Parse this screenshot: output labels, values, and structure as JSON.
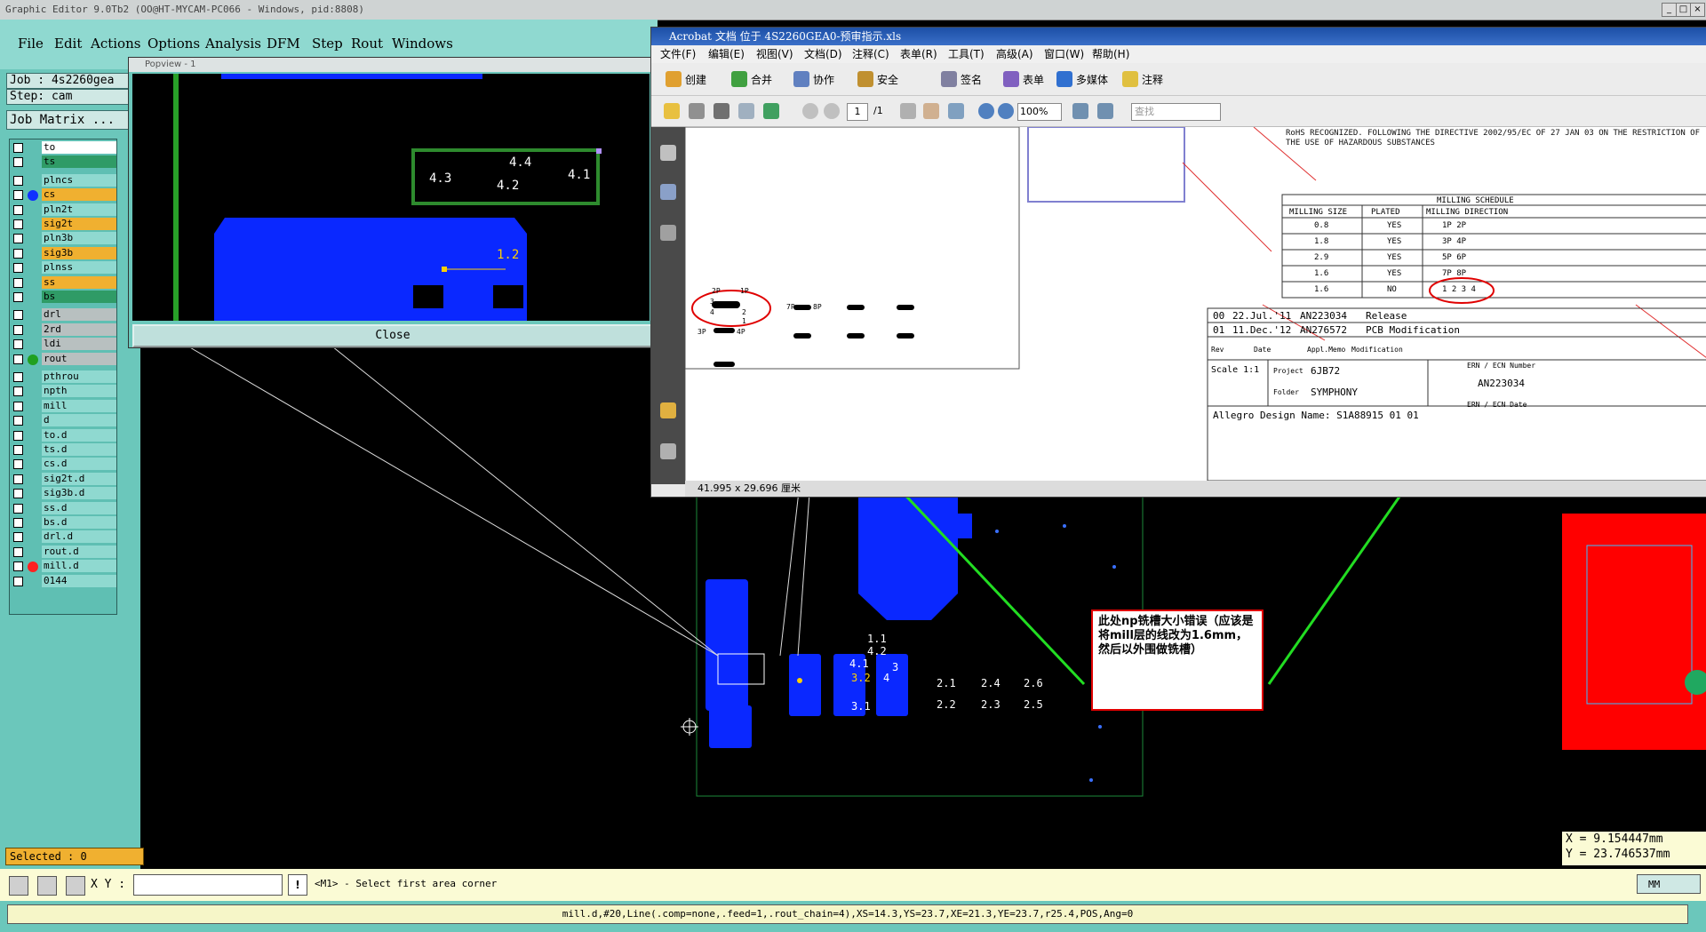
{
  "window": {
    "title": "Graphic Editor 9.0Tb2 (OO@HT-MYCAM-PC066 - Windows, pid:8808)",
    "btn_min": "_",
    "btn_max": "□",
    "btn_close": "×"
  },
  "menubar": {
    "items": [
      "File",
      "Edit",
      "Actions",
      "Options",
      "Analysis",
      "DFM",
      "Step",
      "Rout",
      "Windows"
    ]
  },
  "job": {
    "job_label": "Job : 4s2260gea",
    "step_label": "Step: cam",
    "matrix_label": "Job Matrix ..."
  },
  "layers": [
    {
      "name": "to",
      "color": "#ffffff",
      "dot": ""
    },
    {
      "name": "ts",
      "color": "#2f9b66",
      "dot": ""
    },
    {
      "name": "plncs",
      "color": "#8fd9d0",
      "dot": ""
    },
    {
      "name": "cs",
      "color": "#f0b030",
      "dot": "#1030ff"
    },
    {
      "name": "pln2t",
      "color": "#8fd9d0",
      "dot": ""
    },
    {
      "name": "sig2t",
      "color": "#f0b030",
      "dot": ""
    },
    {
      "name": "pln3b",
      "color": "#8fd9d0",
      "dot": ""
    },
    {
      "name": "sig3b",
      "color": "#f0b030",
      "dot": ""
    },
    {
      "name": "plnss",
      "color": "#8fd9d0",
      "dot": ""
    },
    {
      "name": "ss",
      "color": "#f0b030",
      "dot": ""
    },
    {
      "name": "bs",
      "color": "#2f9b66",
      "dot": ""
    },
    {
      "name": "drl",
      "color": "#b8c0c0",
      "dot": ""
    },
    {
      "name": "2rd",
      "color": "#b8c0c0",
      "dot": ""
    },
    {
      "name": "ldi",
      "color": "#b8c0c0",
      "dot": ""
    },
    {
      "name": "rout",
      "color": "#b8c0c0",
      "dot": "#20a020"
    },
    {
      "name": "pthrou",
      "color": "#8fd9d0",
      "dot": ""
    },
    {
      "name": "npth",
      "color": "#8fd9d0",
      "dot": ""
    },
    {
      "name": "mill",
      "color": "#8fd9d0",
      "dot": ""
    },
    {
      "name": "d",
      "color": "#8fd9d0",
      "dot": ""
    },
    {
      "name": "to.d",
      "color": "#8fd9d0",
      "dot": ""
    },
    {
      "name": "ts.d",
      "color": "#8fd9d0",
      "dot": ""
    },
    {
      "name": "cs.d",
      "color": "#8fd9d0",
      "dot": ""
    },
    {
      "name": "sig2t.d",
      "color": "#8fd9d0",
      "dot": ""
    },
    {
      "name": "sig3b.d",
      "color": "#8fd9d0",
      "dot": ""
    },
    {
      "name": "ss.d",
      "color": "#8fd9d0",
      "dot": ""
    },
    {
      "name": "bs.d",
      "color": "#8fd9d0",
      "dot": ""
    },
    {
      "name": "drl.d",
      "color": "#8fd9d0",
      "dot": ""
    },
    {
      "name": "rout.d",
      "color": "#8fd9d0",
      "dot": ""
    },
    {
      "name": "mill.d",
      "color": "#8fd9d0",
      "dot": "#ff2020"
    },
    {
      "name": "0144",
      "color": "#8fd9d0",
      "dot": ""
    }
  ],
  "selected": "Selected : 0",
  "popview": {
    "title": "Popview - 1",
    "close": "Close",
    "labels": [
      "4.4",
      "4.3",
      "4.2",
      "4.1",
      "1.2"
    ]
  },
  "acrobat": {
    "title": "Acrobat 文档 位于 4S2260GEA0-预审指示.xls",
    "menu": [
      "文件(F)",
      "编辑(E)",
      "视图(V)",
      "文档(D)",
      "注释(C)",
      "表单(R)",
      "工具(T)",
      "高级(A)",
      "窗口(W)",
      "帮助(H)"
    ],
    "toolbar": [
      "创建",
      "合并",
      "协作",
      "安全",
      "签名",
      "表单",
      "多媒体",
      "注释"
    ],
    "page_value": "1",
    "page_total": "/1",
    "zoom": "100%",
    "search_placeholder": "查找",
    "page_size": "41.995 x 29.696 厘米"
  },
  "pdf": {
    "rohs": "RoHS RECOGNIZED. FOLLOWING THE DIRECTIVE 2002/95/EC OF 27 JAN 03 ON THE RESTRICTION OF THE USE OF HAZARDOUS SUBSTANCES",
    "schedule_title": "MILLING SCHEDULE",
    "schedule_headers": [
      "MILLING SIZE",
      "PLATED",
      "MILLING DIRECTION"
    ],
    "schedule_rows": [
      [
        "0.8",
        "YES",
        "1P  2P"
      ],
      [
        "1.8",
        "YES",
        "3P  4P"
      ],
      [
        "2.9",
        "YES",
        "5P  6P"
      ],
      [
        "1.6",
        "YES",
        "7P  8P"
      ],
      [
        "1.6",
        "NO",
        "1 2 3 4"
      ]
    ],
    "rev_rows": [
      [
        "00",
        "22.Jul.'11",
        "AN223034",
        "Release"
      ],
      [
        "01",
        "11.Dec.'12",
        "AN276572",
        "PCB Modification"
      ]
    ],
    "rev_headers": [
      "Rev",
      "Date",
      "Appl.Memo",
      "Modification"
    ],
    "scale": "Scale 1:1",
    "project_label": "Project",
    "project": "6JB72",
    "folder_label": "Folder",
    "folder": "SYMPHONY",
    "ern_label": "ERN / ECN Number",
    "ern": "AN223034",
    "ern_date": "ERN / ECN Date",
    "design_name": "Allegro Design Name: S1A88915 01 01",
    "slot_labels": [
      "2P",
      "1P",
      "3",
      "4",
      "2",
      "1",
      "3P",
      "4P",
      "7P",
      "8P"
    ]
  },
  "board_labels": [
    "1.1",
    "4.2",
    "4.1",
    "3",
    "4",
    "3.2",
    "3.1",
    "2.1",
    "2.2",
    "2.4",
    "2.3",
    "2.6",
    "2.5"
  ],
  "note": "此处np铣槽大小错误（应该是将mill层的线改为1.6mm，然后以外围做铣槽）",
  "coord": {
    "x": "X = 9.154447mm",
    "y": "Y = 23.746537mm"
  },
  "bottom": {
    "xy_label": "X Y :",
    "xy_value": "",
    "prompt": "<M1> - Select first area corner",
    "units": "MM"
  },
  "status_line": "mill.d,#20,Line(.comp=none,.feed=1,.rout_chain=4),XS=14.3,YS=23.7,XE=21.3,YE=23.7,r25.4,POS,Ang=0",
  "colors": {
    "panel": "#6bc7bb",
    "copper": "#0a28ff",
    "annotation_arrow": "#22dd22",
    "highlight_red": "#ff0000"
  }
}
